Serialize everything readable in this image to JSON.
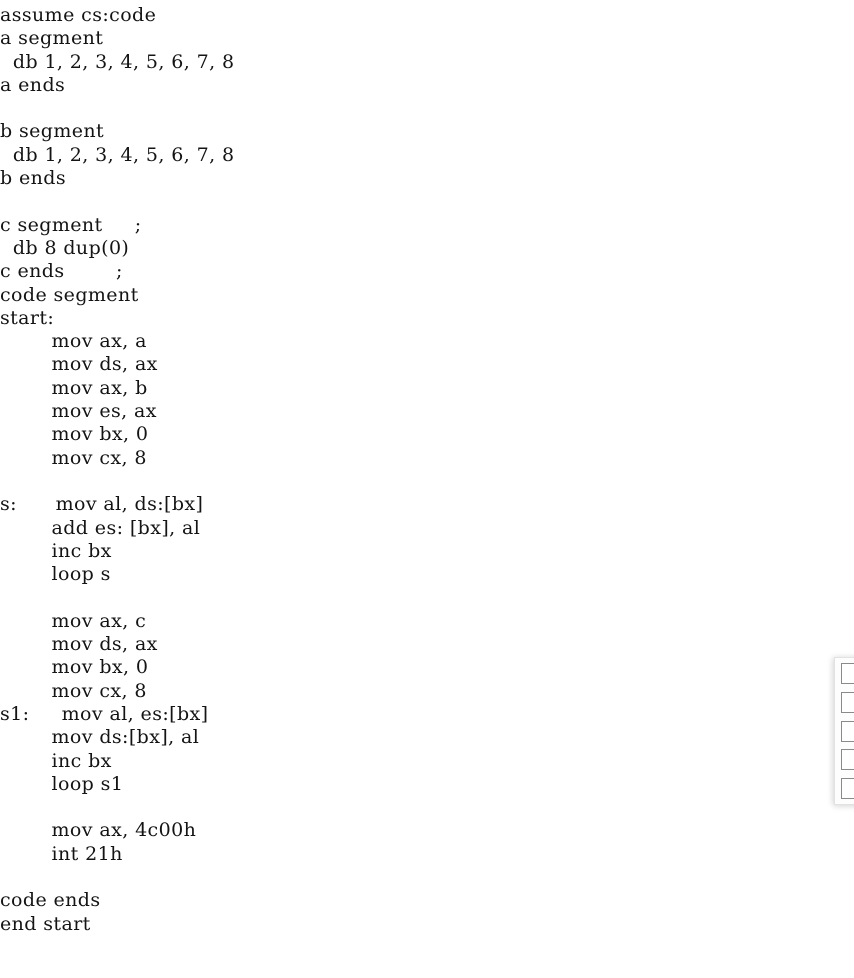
{
  "document": {
    "type": "assembly-source-listing",
    "language": "x86 assembly (MASM)",
    "background_color": "#ffffff",
    "text_color": "#141414",
    "lines": [
      "assume cs:code",
      "a segment",
      "  db 1, 2, 3, 4, 5, 6, 7, 8",
      "a ends",
      "",
      "b segment",
      "  db 1, 2, 3, 4, 5, 6, 7, 8",
      "b ends",
      "",
      "c segment     ;",
      "  db 8 dup(0)",
      "c ends        ;",
      "code segment",
      "start:",
      "        mov ax, a",
      "        mov ds, ax",
      "        mov ax, b",
      "        mov es, ax",
      "        mov bx, 0",
      "        mov cx, 8",
      "",
      "s:      mov al, ds:[bx]",
      "        add es: [bx], al",
      "        inc bx",
      "        loop s",
      "",
      "        mov ax, c",
      "        mov ds, ax",
      "        mov bx, 0",
      "        mov cx, 8",
      "s1:     mov al, es:[bx]",
      "        mov ds:[bx], al",
      "        inc bx",
      "        loop s1",
      "",
      "        mov ax, 4c00h",
      "        int 21h",
      "",
      "code ends",
      "end start"
    ]
  },
  "floating_panel": {
    "label": "cut-off side panel",
    "border_color": "#e2e2e2",
    "box_border_color": "#8a8a8a",
    "box_count": 5,
    "boxes": [
      "",
      "",
      "",
      "",
      ""
    ]
  }
}
